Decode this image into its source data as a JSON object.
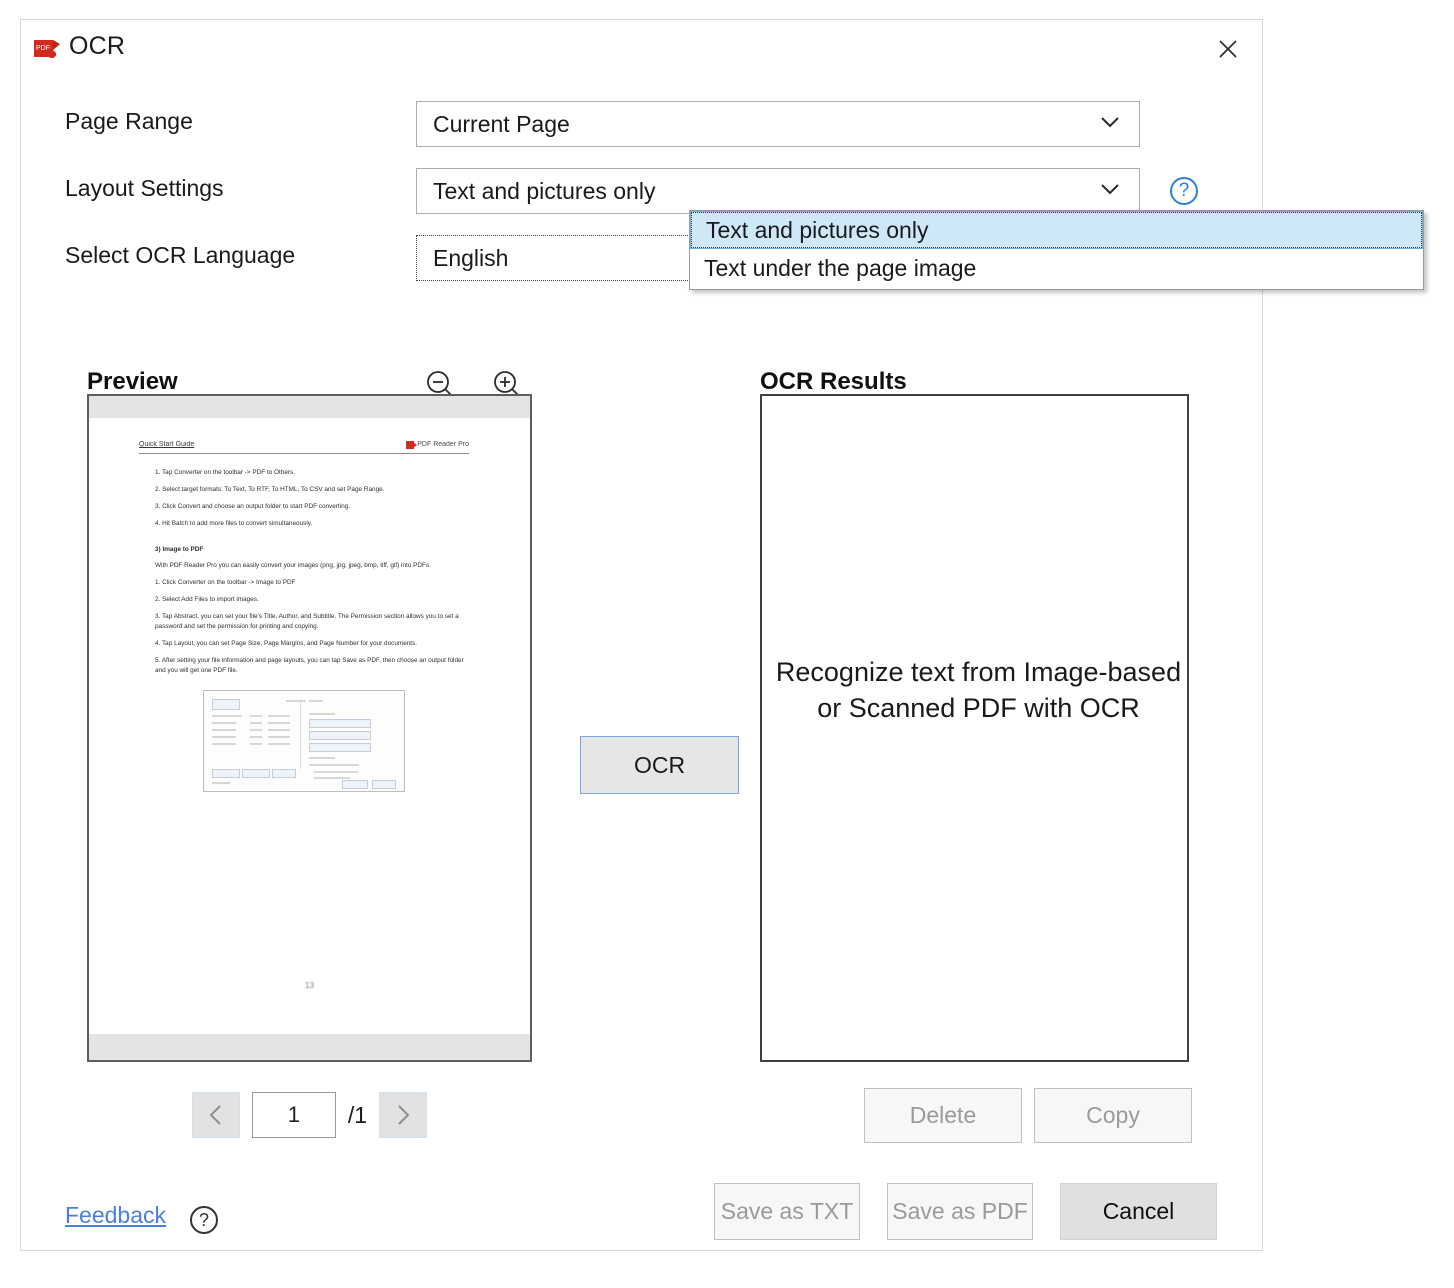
{
  "window": {
    "title": "OCR",
    "icon": "pdf-file-icon",
    "close_label": "✕"
  },
  "form": {
    "rows": [
      {
        "label": "Page Range",
        "value": "Current Page",
        "type": "dropdown",
        "name": "page-range"
      },
      {
        "label": "Layout Settings",
        "value": "Text and pictures only",
        "type": "dropdown",
        "name": "layout-settings",
        "help": "?"
      },
      {
        "label": "Select OCR Language",
        "value": "English",
        "type": "dropdown-focused",
        "name": "select-ocr-language"
      }
    ]
  },
  "dropdown": {
    "open_for": "Layout Settings",
    "options": [
      {
        "label": "Text and pictures only",
        "selected": true
      },
      {
        "label": "Text under the page image",
        "selected": false
      }
    ]
  },
  "preview": {
    "title": "Preview",
    "zoom_out_icon": "zoom-out-icon",
    "zoom_in_icon": "zoom-in-icon",
    "page_number": "1",
    "page_total": "/1",
    "prev_icon": "‹",
    "next_icon": "›",
    "document": {
      "header_left": "Quick Start Guide",
      "header_right": "PDF Reader Pro",
      "page_label": "13",
      "lines": [
        "1. Tap Converter on the toolbar -> PDF to Others.",
        "2. Select target formats: To Text, To RTF, To HTML, To CSV and set Page Range.",
        "3. Click Convert and choose an output folder to start PDF converting.",
        "4. Hit Batch to add more files to convert simultaneously.",
        "3) Image to PDF",
        "With PDF Reader Pro you can easily convert your images (png, jpg, jpeg, bmp, tiff, gif) into PDFs.",
        "1. Click Converter on the toolbar -> Image to PDF",
        "2. Select Add Files to import images.",
        "3. Tap Abstract, you can set your file's Title, Author, and Subtitle. The Permission section allows you to set a password and set the permission for printing and copying.",
        "4. Tap Layout, you can set Page Size, Page Margins, and Page Number for your documents.",
        "5. After setting your file information and page layouts, you can tap Save as PDF, then choose an output folder and you will get one PDF file."
      ]
    }
  },
  "results": {
    "title": "OCR Results",
    "placeholder_text": "Recognize text from Image-based or Scanned PDF with OCR",
    "delete_label": "Delete",
    "copy_label": "Copy"
  },
  "actions": {
    "ocr_label": "OCR",
    "save_txt_label": "Save as TXT",
    "save_pdf_label": "Save as PDF",
    "cancel_label": "Cancel"
  },
  "footer": {
    "feedback_label": "Feedback",
    "feedback_help": "?"
  },
  "colors": {
    "accent_blue": "#2f7fd8",
    "link_blue": "#4a7fe0",
    "highlight": "#cfe8f7",
    "pdf_red": "#d32a1f"
  }
}
